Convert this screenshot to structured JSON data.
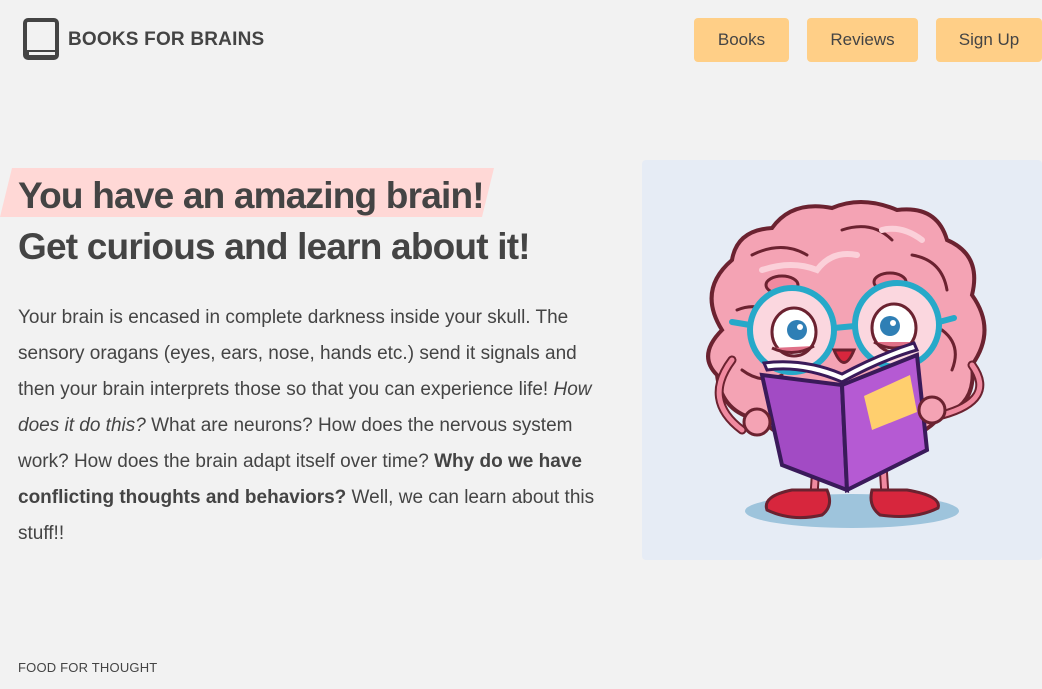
{
  "header": {
    "brand": "BOOKS FOR BRAINS",
    "logo_icon": "book-icon",
    "nav": [
      {
        "label": "Books"
      },
      {
        "label": "Reviews"
      },
      {
        "label": "Sign Up"
      }
    ]
  },
  "hero": {
    "headline_1": "You have an amazing brain!",
    "headline_2": "Get curious and learn about it!",
    "body": {
      "p1": "Your brain is encased in complete darkness inside your skull. The sensory oragans (eyes, ears, nose, hands etc.) send it signals and then your brain interprets those so that you can experience life! ",
      "p2_italic": "How does it do this?",
      "p3": " What are neurons? How does the nervous system work? How does the brain adapt itself over time? ",
      "p4_bold": "Why do we have conflicting thoughts and behaviors?",
      "p5": " Well, we can learn about this stuff!!"
    },
    "image_subject": "cartoon-brain-reading-book"
  },
  "footer": {
    "text": "FOOD FOR THOUGHT"
  },
  "colors": {
    "background": "#f2f2f2",
    "button": "#ffcf87",
    "highlight": "#ffd8d6",
    "text": "#444444",
    "illustration_bg": "#e6ecf5"
  }
}
